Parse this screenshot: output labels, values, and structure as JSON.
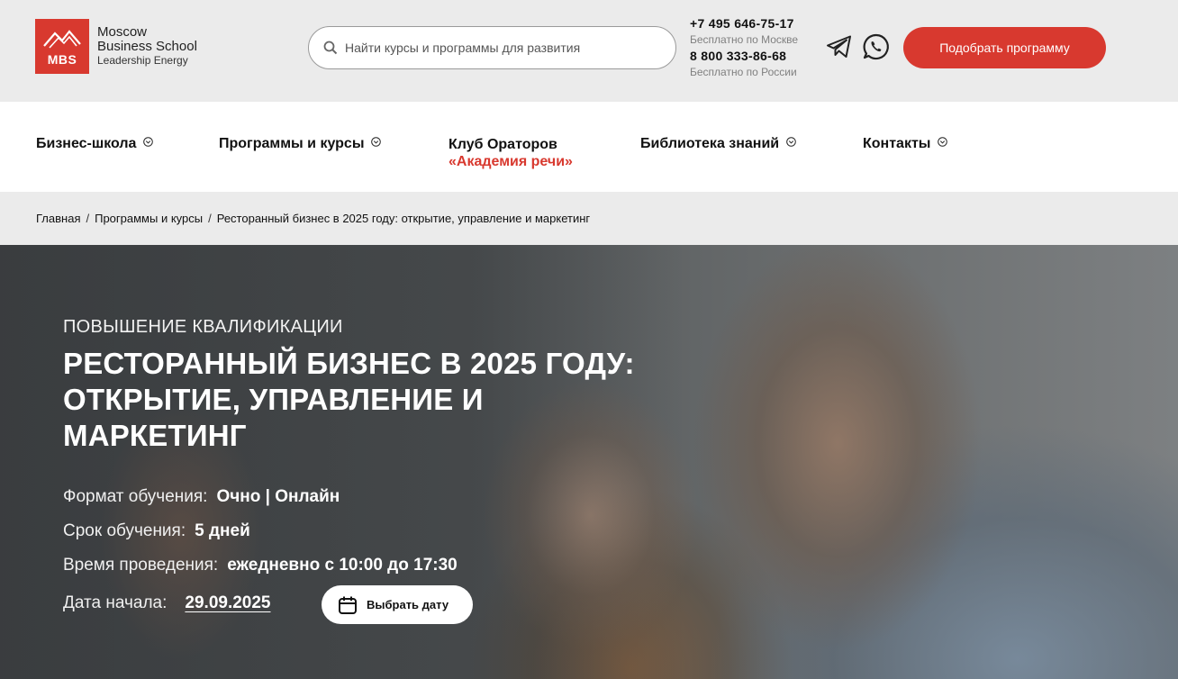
{
  "header": {
    "logo": {
      "abbr": "MBS",
      "line1": "Moscow",
      "line2": "Business School",
      "line3": "Leadership Energy"
    },
    "search": {
      "placeholder": "Найти курсы и программы для развития",
      "icon": "search-icon"
    },
    "phones": {
      "moscow_number": "+7 495 646-75-17",
      "moscow_note": "Бесплатно по Москве",
      "russia_number": "8 800 333-86-68",
      "russia_note": "Бесплатно по России"
    },
    "social": {
      "telegram_icon": "telegram-icon",
      "whatsapp_icon": "whatsapp-icon"
    },
    "cta_label": "Подобрать программу",
    "accent_color": "#d8392f"
  },
  "nav": {
    "items": [
      {
        "label": "Бизнес-школа",
        "has_dropdown": true
      },
      {
        "label": "Программы и курсы",
        "has_dropdown": true
      },
      {
        "label": "Клуб Ораторов",
        "sublabel": "«Академия речи»",
        "has_dropdown": false
      },
      {
        "label": "Библиотека знаний",
        "has_dropdown": true
      },
      {
        "label": "Контакты",
        "has_dropdown": true
      }
    ]
  },
  "breadcrumb": {
    "separator": "/",
    "items": [
      "Главная",
      "Программы и курсы",
      "Ресторанный бизнес в 2025 году: открытие, управление и маркетинг"
    ]
  },
  "hero": {
    "eyebrow": "ПОВЫШЕНИЕ КВАЛИФИКАЦИИ",
    "title": "Ресторанный бизнес в 2025 году: открытие, управление и маркетинг",
    "format_label": "Формат обучения:",
    "format_value": "Очно | Онлайн",
    "duration_label": "Срок обучения:",
    "duration_value": "5 дней",
    "time_label": "Время проведения:",
    "time_value": "ежедневно с 10:00 до 17:30",
    "start_label": "Дата начала:",
    "start_value": "29.09.2025",
    "choose_date_label": "Выбрать дату",
    "calendar_icon": "calendar-icon"
  }
}
